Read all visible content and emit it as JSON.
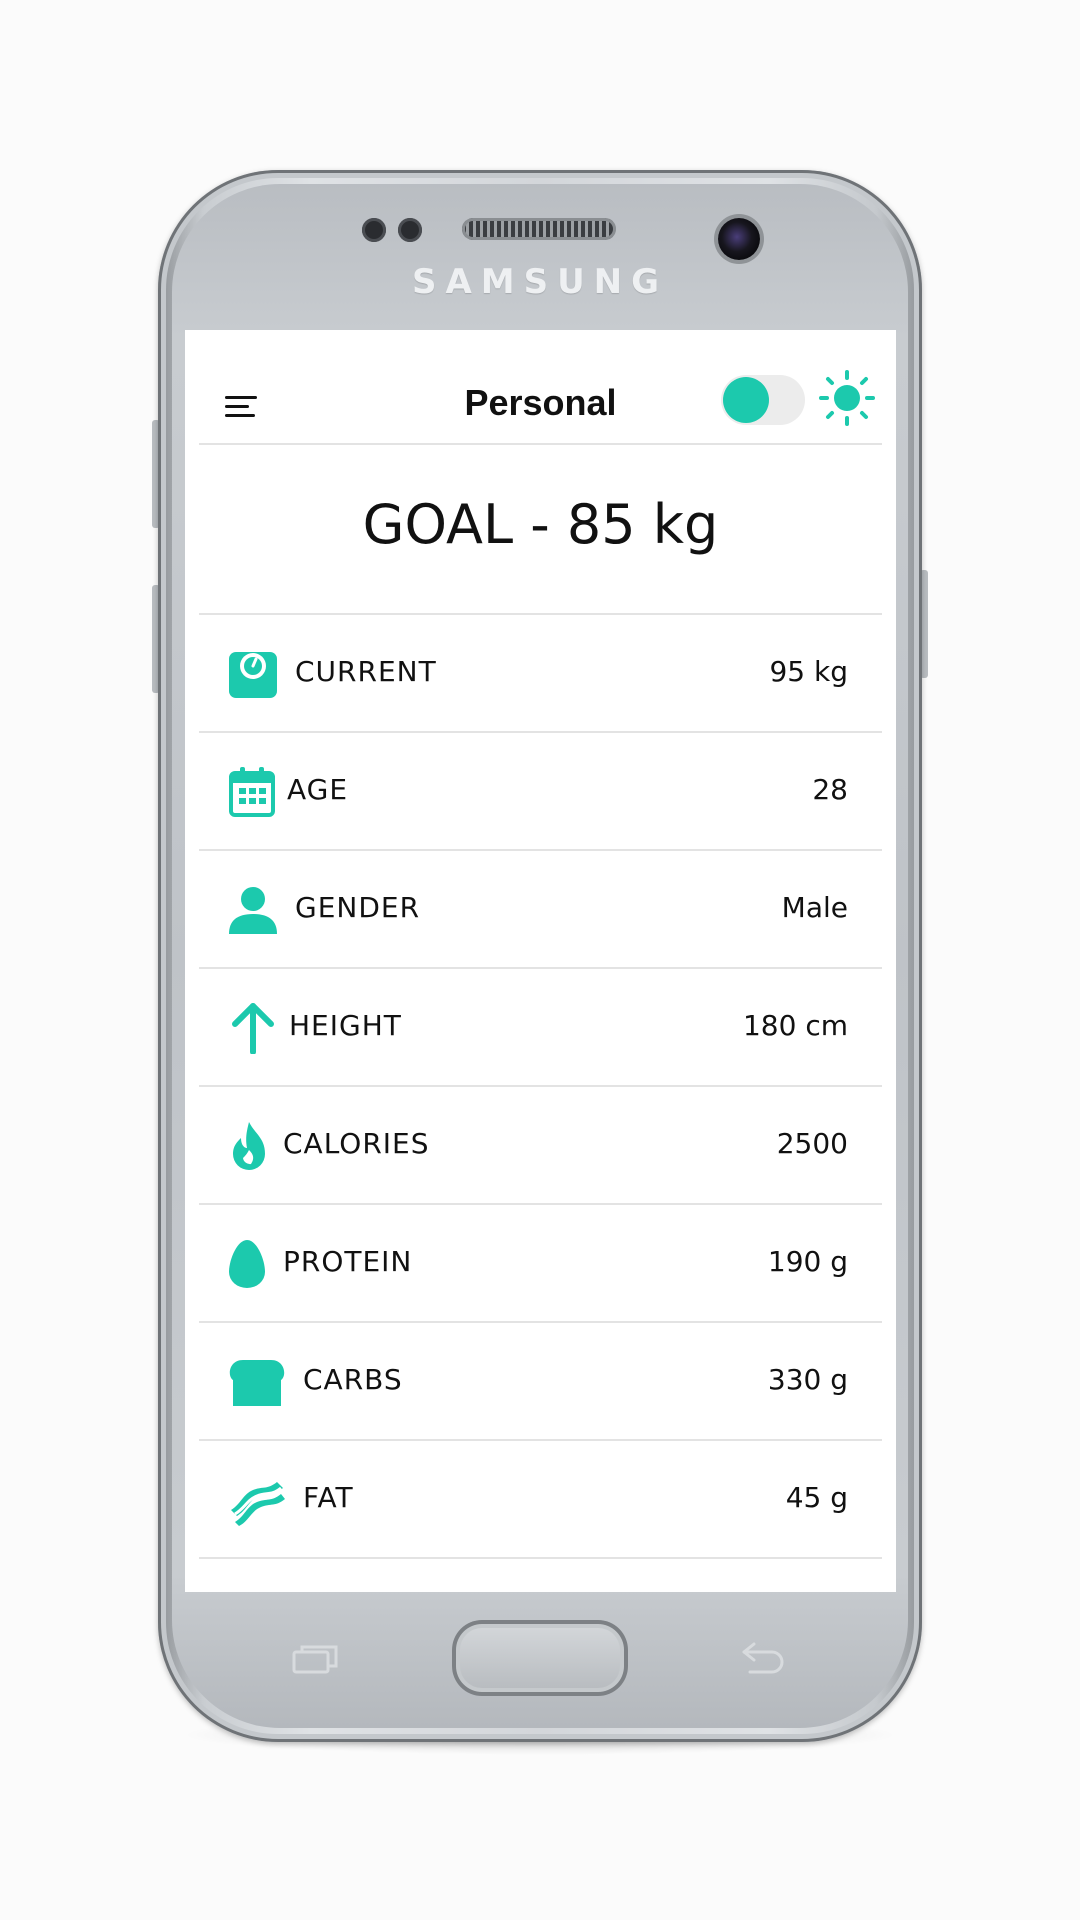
{
  "device": {
    "brand": "SAMSUNG"
  },
  "header": {
    "title": "Personal",
    "menu_icon": "hamburger-menu-icon",
    "toggle_state": "on",
    "theme_icon": "sun-icon"
  },
  "goal": {
    "text": "GOAL - 85 kg"
  },
  "stats": [
    {
      "icon": "scale-icon",
      "label": "CURRENT",
      "value": "95 kg"
    },
    {
      "icon": "calendar-icon",
      "label": "AGE",
      "value": "28"
    },
    {
      "icon": "person-icon",
      "label": "GENDER",
      "value": "Male"
    },
    {
      "icon": "arrow-up-icon",
      "label": "HEIGHT",
      "value": "180 cm"
    },
    {
      "icon": "flame-icon",
      "label": "CALORIES",
      "value": "2500"
    },
    {
      "icon": "egg-icon",
      "label": "PROTEIN",
      "value": "190 g"
    },
    {
      "icon": "bread-icon",
      "label": "CARBS",
      "value": "330 g"
    },
    {
      "icon": "bacon-icon",
      "label": "FAT",
      "value": "45 g"
    }
  ],
  "colors": {
    "accent": "#1cc9ad",
    "text": "#111111",
    "divider": "#e3e3e3"
  }
}
